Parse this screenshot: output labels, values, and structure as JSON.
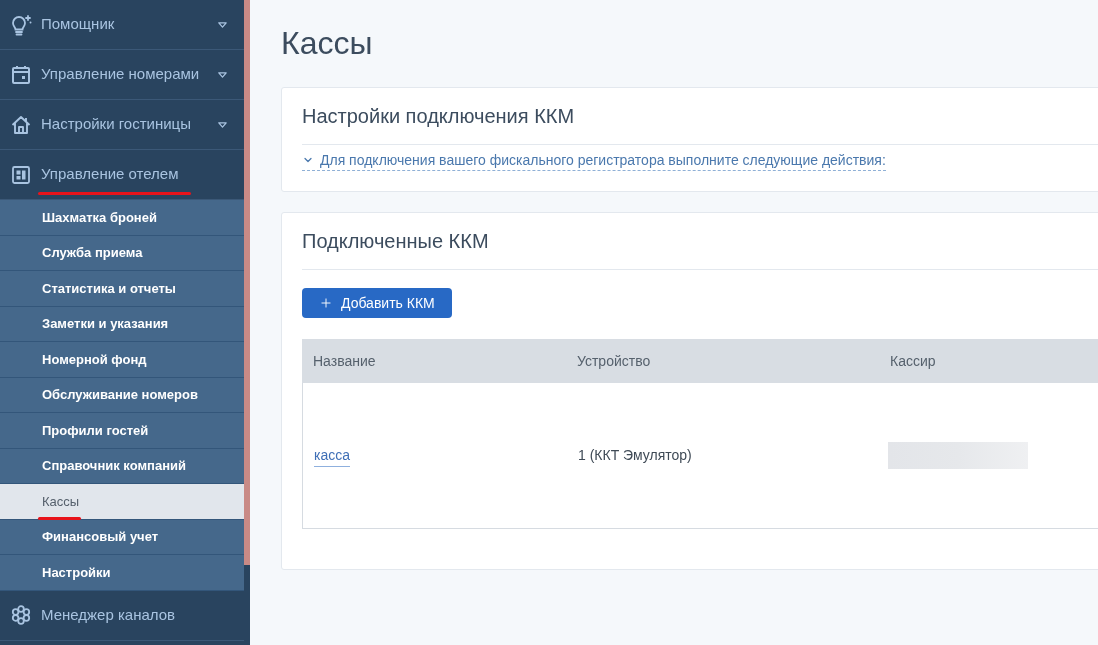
{
  "sidebar": {
    "items": [
      {
        "label": "Помощник",
        "kind": "group",
        "expanded": false,
        "underlined": false
      },
      {
        "label": "Управление номерами",
        "kind": "group",
        "expanded": false,
        "underlined": false
      },
      {
        "label": "Настройки гостиницы",
        "kind": "group",
        "expanded": false,
        "underlined": false
      },
      {
        "label": "Управление отелем",
        "kind": "group",
        "expanded": true,
        "underlined": true,
        "children": [
          {
            "label": "Шахматка броней",
            "selected": false,
            "underlined": false
          },
          {
            "label": "Служба приема",
            "selected": false,
            "underlined": false
          },
          {
            "label": "Статистика и отчеты",
            "selected": false,
            "underlined": false
          },
          {
            "label": "Заметки и указания",
            "selected": false,
            "underlined": false
          },
          {
            "label": "Номерной фонд",
            "selected": false,
            "underlined": false
          },
          {
            "label": "Обслуживание номеров",
            "selected": false,
            "underlined": false
          },
          {
            "label": "Профили гостей",
            "selected": false,
            "underlined": false
          },
          {
            "label": "Справочник компаний",
            "selected": false,
            "underlined": false
          },
          {
            "label": "Кассы",
            "selected": true,
            "underlined": true
          },
          {
            "label": "Финансовый учет",
            "selected": false,
            "underlined": false
          },
          {
            "label": "Настройки",
            "selected": false,
            "underlined": false
          }
        ]
      },
      {
        "label": "Менеджер каналов",
        "kind": "link",
        "underlined": false
      }
    ]
  },
  "page_title": "Кассы",
  "connection_settings": {
    "title": "Настройки подключения ККМ",
    "instructions": {
      "text": "Для подключения вашего фискального регистратора выполните следующие действия:",
      "expanded": false
    }
  },
  "connected_devices": {
    "title": "Подключенные ККМ",
    "add_button": "Добавить ККМ",
    "table": {
      "columns": [
        "Название",
        "Устройство",
        "Кассир"
      ],
      "rows": [
        {
          "cells": [
            {
              "kind": "link",
              "text": "касса"
            },
            {
              "kind": "text",
              "text": "1 (ККТ Эмулятор)"
            },
            {
              "kind": "redacted"
            }
          ]
        }
      ]
    }
  }
}
